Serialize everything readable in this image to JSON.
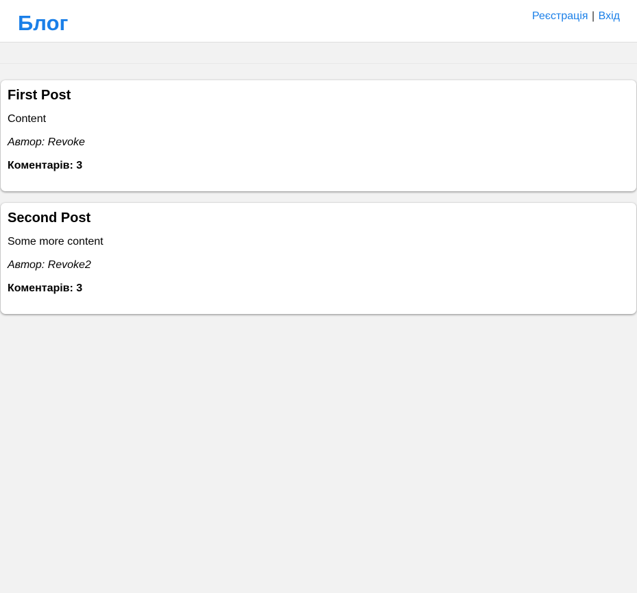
{
  "header": {
    "title": "Блог",
    "register_label": "Реєстрація",
    "separator": "|",
    "login_label": "Вхід"
  },
  "posts": [
    {
      "title": "First Post",
      "content": "Content",
      "author_line": "Автор: Revoke",
      "comments_line": "Коментарів: 3"
    },
    {
      "title": "Second Post",
      "content": "Some more content",
      "author_line": "Автор: Revoke2",
      "comments_line": "Коментарів: 3"
    }
  ],
  "colors": {
    "accent": "#1a7fe8",
    "background": "#f2f2f2",
    "card": "#ffffff"
  }
}
